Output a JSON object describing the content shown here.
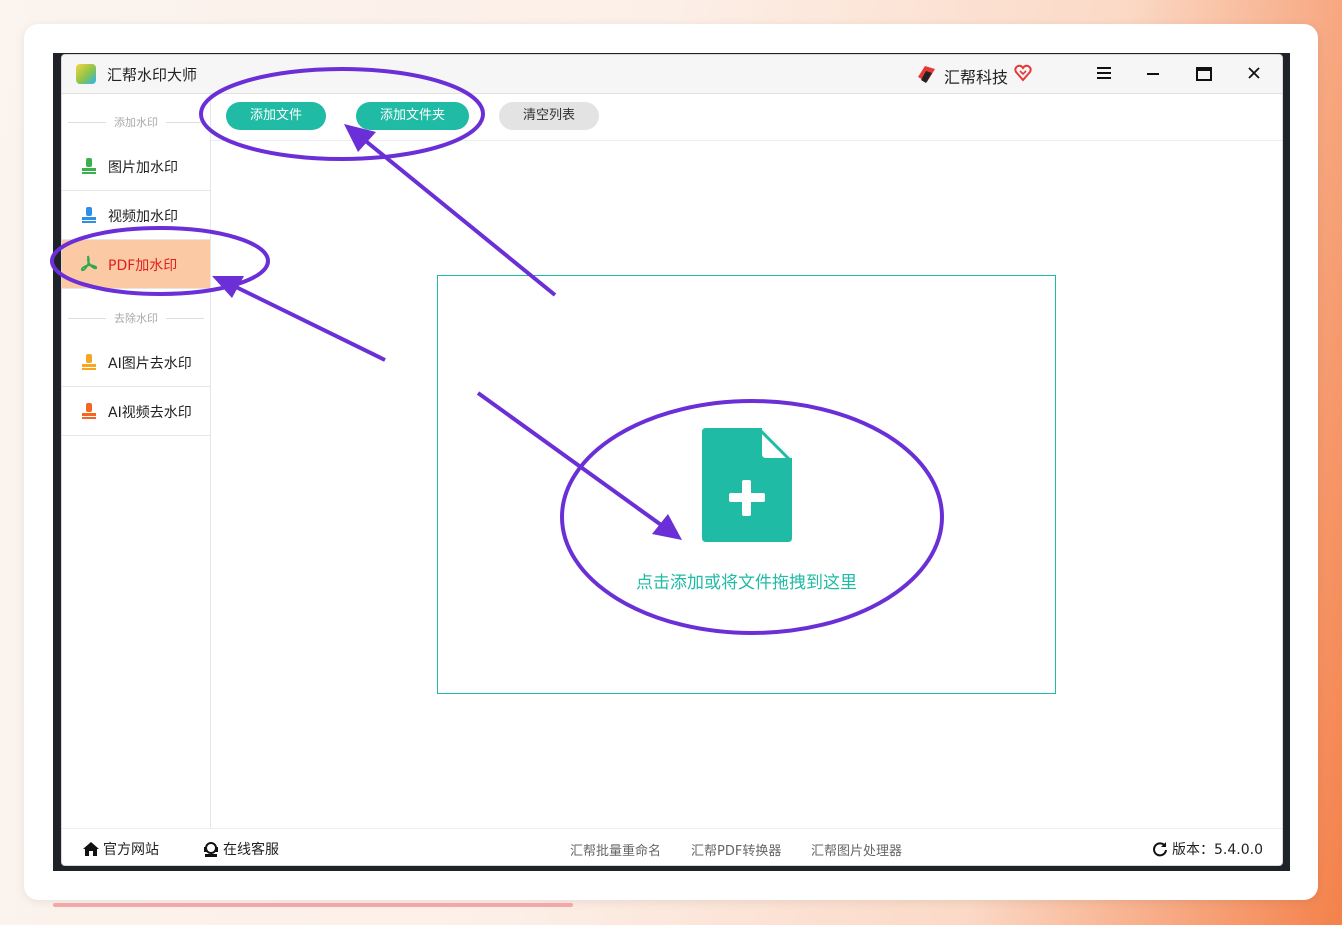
{
  "app": {
    "title": "汇帮水印大师",
    "brand": "汇帮科技"
  },
  "window_controls": {
    "menu": "≡",
    "minimize": "—",
    "maximize": "☐",
    "close": "✕"
  },
  "sidebar": {
    "section_add": "添加水印",
    "section_remove": "去除水印",
    "items": [
      {
        "label": "图片加水印",
        "icon": "image-stamp-icon",
        "color": "#3cb04a"
      },
      {
        "label": "视频加水印",
        "icon": "video-stamp-icon",
        "color": "#2f8fe6"
      },
      {
        "label": "PDF加水印",
        "icon": "pdf-icon",
        "color": "#2fa84f",
        "active": true
      },
      {
        "label": "AI图片去水印",
        "icon": "ai-image-stamp-icon",
        "color": "#f5a623"
      },
      {
        "label": "AI视频去水印",
        "icon": "ai-video-stamp-icon",
        "color": "#f26522"
      }
    ]
  },
  "toolbar": {
    "add_file": "添加文件",
    "add_folder": "添加文件夹",
    "clear_list": "清空列表"
  },
  "dropzone": {
    "text": "点击添加或将文件拖拽到这里",
    "icon": "add-file-icon"
  },
  "footer": {
    "website": "官方网站",
    "support": "在线客服",
    "tools": [
      "汇帮批量重命名",
      "汇帮PDF转换器",
      "汇帮图片处理器"
    ],
    "version": "版本：5.4.0.0"
  },
  "colors": {
    "accent": "#1fbba5",
    "active_bg": "#fbc9a3",
    "active_text": "#e02020",
    "annotation": "#6a2fd6"
  }
}
